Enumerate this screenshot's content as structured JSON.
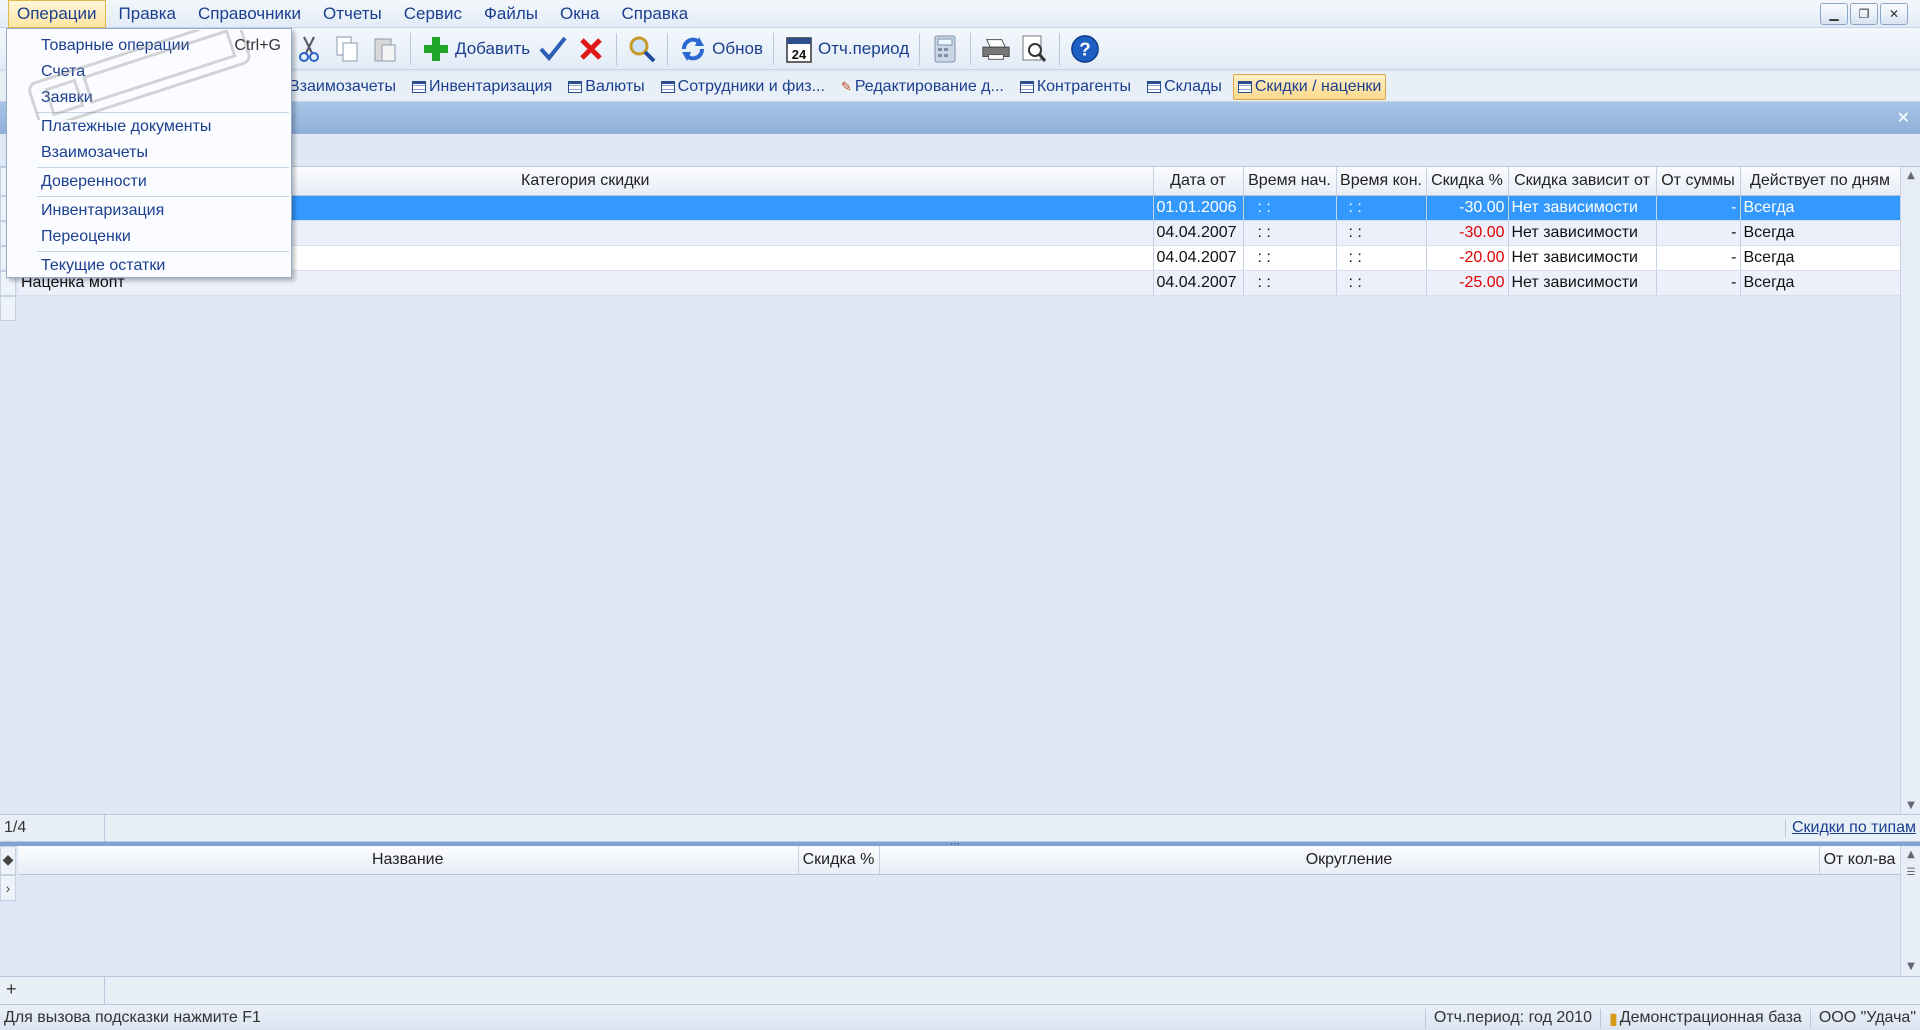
{
  "menubar": {
    "items": [
      "Операции",
      "Правка",
      "Справочники",
      "Отчеты",
      "Сервис",
      "Файлы",
      "Окна",
      "Справка"
    ]
  },
  "dropdown": {
    "items": [
      {
        "label": "Товарные операции",
        "shortcut": "Ctrl+G"
      },
      {
        "label": "Счета"
      },
      {
        "label": "Заявки"
      },
      {
        "label": "Платежные документы"
      },
      {
        "label": "Взаимозачеты"
      },
      {
        "label": "Доверенности"
      },
      {
        "label": "Инвентаризация"
      },
      {
        "label": "Переоценки"
      },
      {
        "label": "Текущие остатки"
      }
    ]
  },
  "toolbar": {
    "add_label": "Добавить",
    "refresh_label": "Обнов",
    "period_label": "Отч.период",
    "calendar_day": "24"
  },
  "tabs": [
    "Взаимозачеты",
    "Инвентаризация",
    "Валюты",
    "Сотрудники и физ...",
    "Редактирование д...",
    "Контрагенты",
    "Склады",
    "Скидки / наценки"
  ],
  "grid": {
    "columns": [
      "Категория скидки",
      "Дата от",
      "Время нач.",
      "Время кон.",
      "Скидка %",
      "Скидка зависит от",
      "От суммы",
      "Действует по дням"
    ],
    "rows": [
      {
        "category": "",
        "date": "01.01.2006",
        "start": ":  :",
        "end": ":  :",
        "discount": "-30.00",
        "depends": "Нет зависимости",
        "from_sum": "-",
        "days": "Всегда"
      },
      {
        "category": "",
        "date": "04.04.2007",
        "start": ":  :",
        "end": ":  :",
        "discount": "-30.00",
        "depends": "Нет зависимости",
        "from_sum": "-",
        "days": "Всегда"
      },
      {
        "category": "",
        "date": "04.04.2007",
        "start": ":  :",
        "end": ":  :",
        "discount": "-20.00",
        "depends": "Нет зависимости",
        "from_sum": "-",
        "days": "Всегда"
      },
      {
        "category": "Наценка мопт",
        "date": "04.04.2007",
        "start": ":  :",
        "end": ":  :",
        "discount": "-25.00",
        "depends": "Нет зависимости",
        "from_sum": "-",
        "days": "Всегда"
      }
    ]
  },
  "grid_status": {
    "record_count": "1/4",
    "types_link": "Скидки по типам"
  },
  "detail": {
    "columns": [
      "Название",
      "Скидка %",
      "Округление",
      "От кол-ва"
    ]
  },
  "statusbar": {
    "hint": "Для вызова подсказки нажмите F1",
    "period": "Отч.период: год 2010",
    "database": "Демонстрационная база",
    "company": "ООО \"Удача\""
  },
  "colors": {
    "selection": "#3399ff",
    "negative": "#e00000",
    "active_tab": "#fcd98b"
  }
}
